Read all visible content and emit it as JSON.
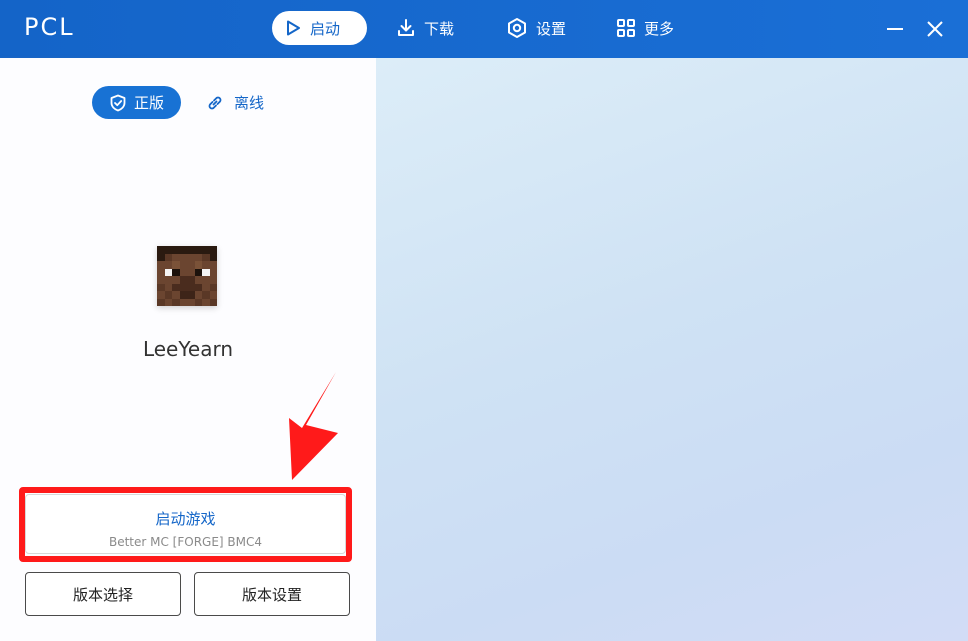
{
  "app": {
    "logo": "PCL"
  },
  "nav": {
    "launch": "启动",
    "download": "下载",
    "settings": "设置",
    "more": "更多"
  },
  "account": {
    "mode_official": "正版",
    "mode_offline": "离线",
    "username": "LeeYearn"
  },
  "launch": {
    "title": "启动游戏",
    "version": "Better MC [FORGE] BMC4"
  },
  "buttons": {
    "version_select": "版本选择",
    "version_settings": "版本设置"
  },
  "colors": {
    "accent": "#1466c8",
    "titlebar": "#1464c8",
    "highlight": "#ff1a1a"
  }
}
